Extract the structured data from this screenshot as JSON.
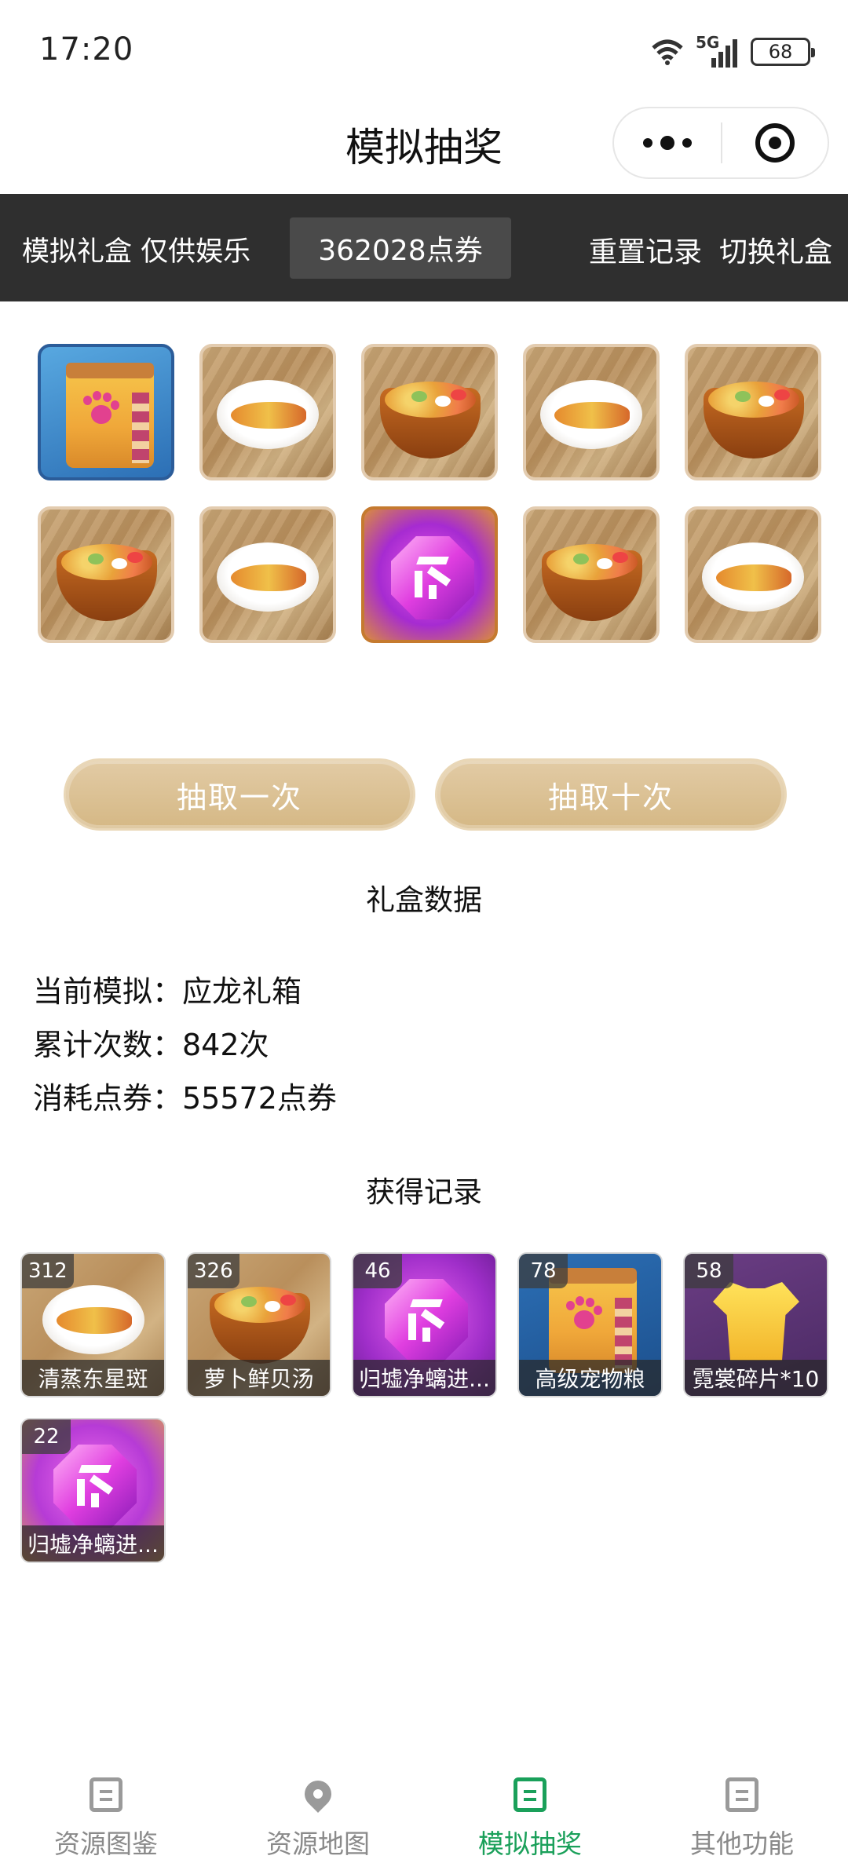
{
  "status_bar": {
    "time": "17:20",
    "network": "5G",
    "battery": "68"
  },
  "nav": {
    "title": "模拟抽奖"
  },
  "toolbar": {
    "left_label": "模拟礼盒 仅供娱乐",
    "tickets": "362028点券",
    "reset_label": "重置记录",
    "switch_label": "切换礼盒"
  },
  "prize_grid": [
    {
      "type": "pet-food-bag"
    },
    {
      "type": "steamed-fish"
    },
    {
      "type": "seafood-soup"
    },
    {
      "type": "steamed-fish"
    },
    {
      "type": "seafood-soup"
    },
    {
      "type": "seafood-soup"
    },
    {
      "type": "steamed-fish"
    },
    {
      "type": "purple-gem"
    },
    {
      "type": "seafood-soup"
    },
    {
      "type": "steamed-fish"
    }
  ],
  "buttons": {
    "draw_once": "抽取一次",
    "draw_ten": "抽取十次"
  },
  "box_data": {
    "title": "礼盒数据",
    "current_label": "当前模拟：应龙礼箱",
    "total_label": "累计次数：842次",
    "spent_label": "消耗点券：55572点券"
  },
  "records": {
    "title": "获得记录",
    "items": [
      {
        "count": "312",
        "name": "清蒸东星斑"
      },
      {
        "count": "326",
        "name": "萝卜鲜贝汤"
      },
      {
        "count": "46",
        "name": "归墟净螭进..."
      },
      {
        "count": "78",
        "name": "高级宠物粮"
      },
      {
        "count": "58",
        "name": "霓裳碎片*10"
      },
      {
        "count": "22",
        "name": "归墟净螭进..."
      }
    ]
  },
  "tabbar": {
    "tabs": [
      {
        "label": "资源图鉴",
        "icon": "doc-icon"
      },
      {
        "label": "资源地图",
        "icon": "location-pin-icon"
      },
      {
        "label": "模拟抽奖",
        "icon": "doc-icon"
      },
      {
        "label": "其他功能",
        "icon": "doc-icon"
      }
    ],
    "active_index": 2,
    "active_color": "#1aa05a"
  }
}
